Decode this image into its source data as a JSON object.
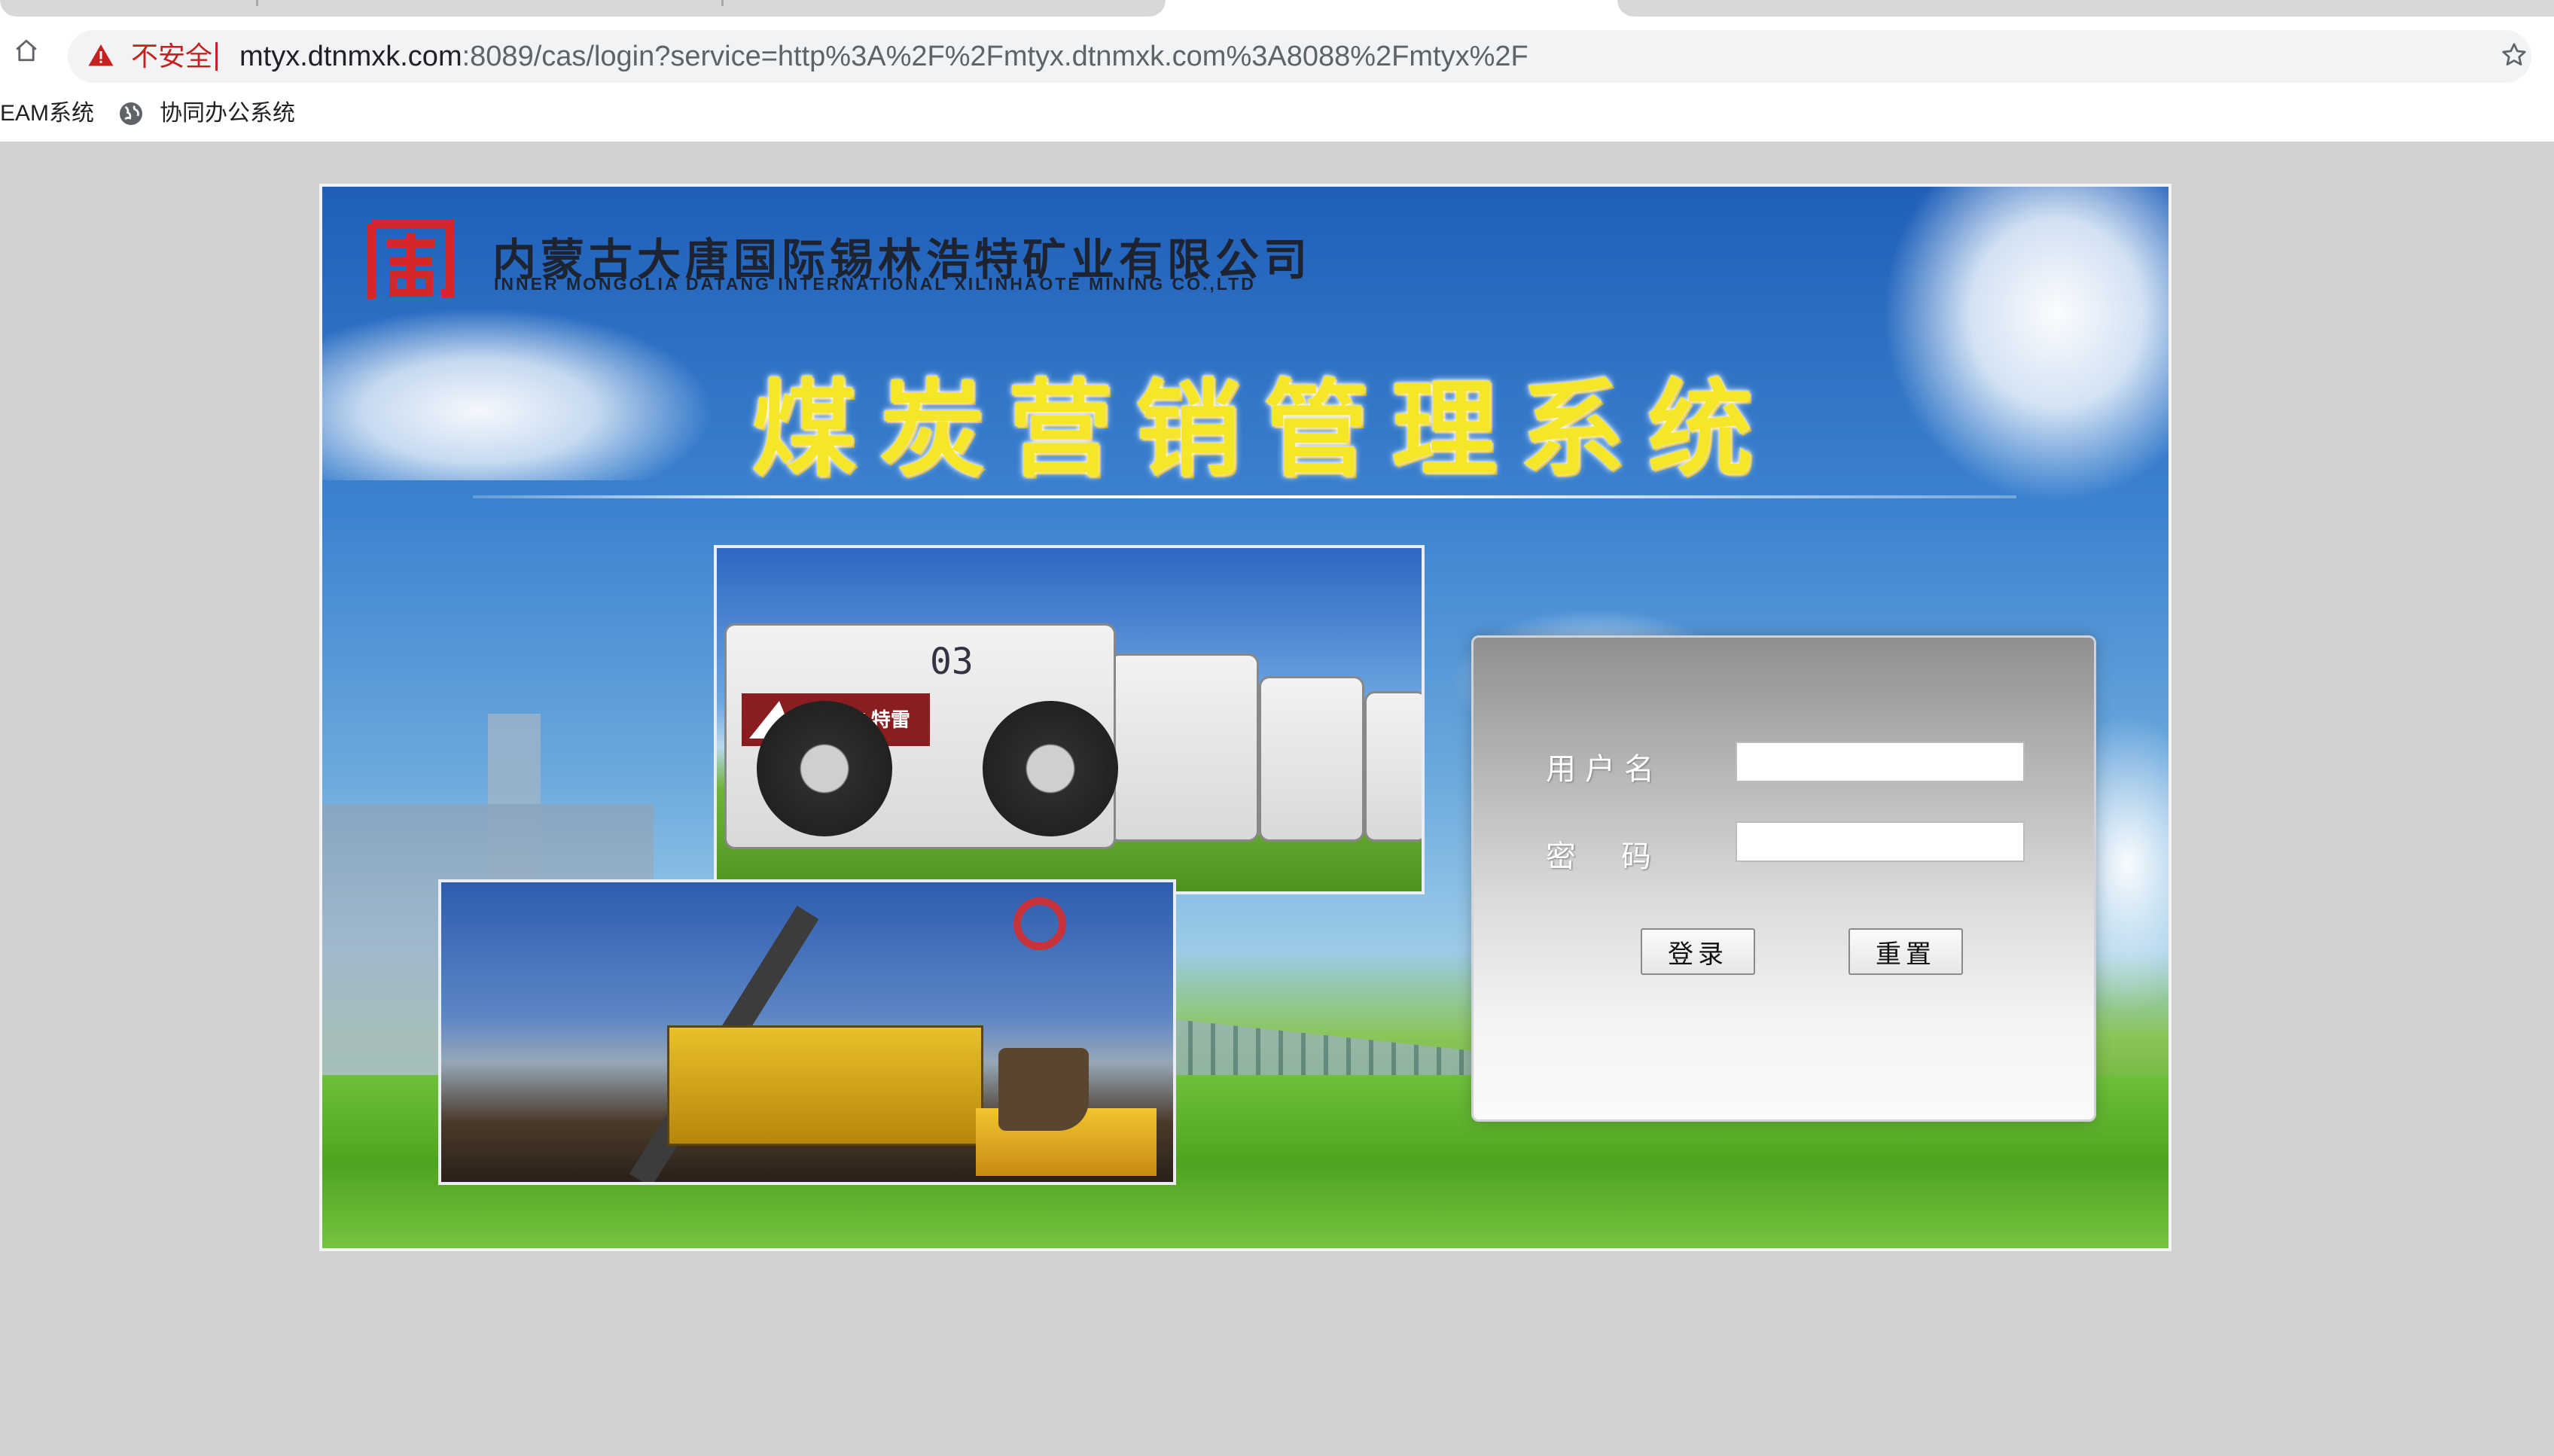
{
  "browser": {
    "security_label": "不安全",
    "url_host": "mtyx.dtnmxk.com",
    "url_path": ":8089/cas/login?service=http%3A%2F%2Fmtyx.dtnmxk.com%3A8088%2Fmtyx%2F",
    "bookmarks": [
      {
        "label": "EAM系统"
      },
      {
        "label": "协同办公系统"
      }
    ]
  },
  "banner": {
    "company_cn": "内蒙古大唐国际锡林浩特矿业有限公司",
    "company_en": "INNER MONGOLIA DATANG INTERNATIONAL XILINHAOTE MINING CO.,LTD",
    "system_title": "煤炭营销管理系统",
    "truck_number": "03",
    "truck_brand": "TEREX 特雷"
  },
  "login": {
    "username_label": "用户名",
    "password_label": "密码",
    "username_value": "",
    "password_value": "",
    "login_button": "登录",
    "reset_button": "重置"
  },
  "colors": {
    "page_background": "#d1d1d1",
    "title_yellow": "#f6e629",
    "logo_red": "#d7252c",
    "insecure_red": "#c5221f"
  }
}
